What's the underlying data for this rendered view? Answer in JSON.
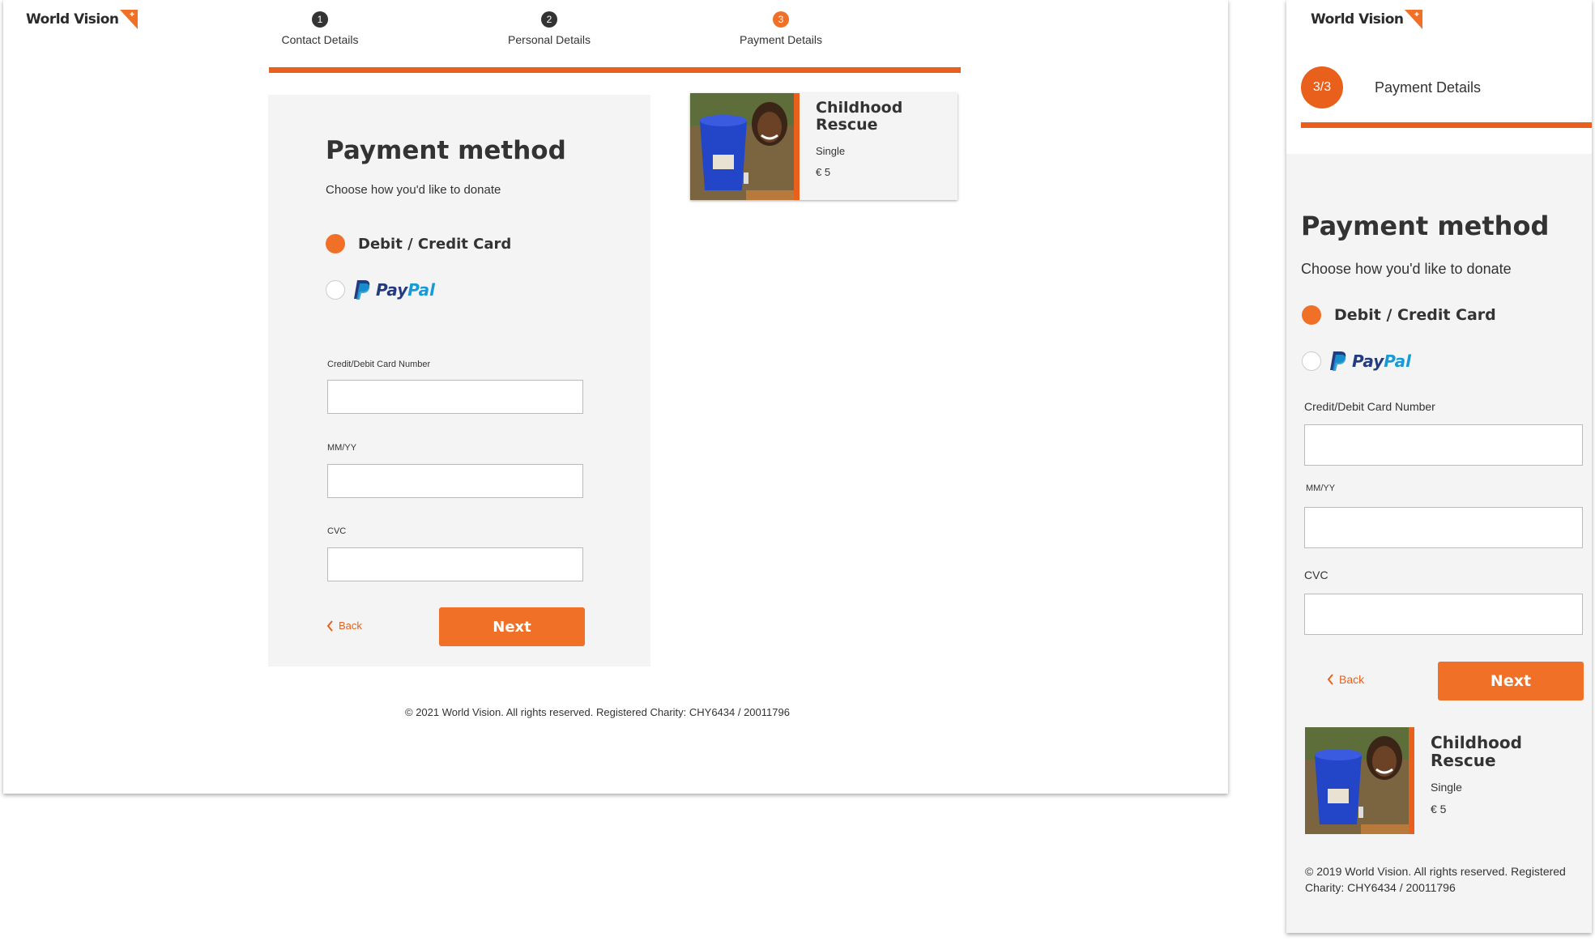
{
  "brand": {
    "name": "World Vision",
    "accent": "#e8601c",
    "accent_light": "#f07028"
  },
  "steps": [
    {
      "num": "1",
      "label": "Contact Details"
    },
    {
      "num": "2",
      "label": "Personal Details"
    },
    {
      "num": "3",
      "label": "Payment Details"
    }
  ],
  "mobile_step": {
    "badge": "3/3",
    "label": "Payment Details"
  },
  "form": {
    "title": "Payment method",
    "subtitle": "Choose how you'd like to donate",
    "options": [
      {
        "label": "Debit / Credit Card",
        "selected": true
      },
      {
        "label_pay": "Pay",
        "label_pal": "Pal",
        "selected": false
      }
    ],
    "fields": [
      {
        "label": "Credit/Debit Card Number",
        "value": ""
      },
      {
        "label": "MM/YY",
        "value": ""
      },
      {
        "label": "CVC",
        "value": ""
      }
    ],
    "back_label": "Back",
    "next_label": "Next"
  },
  "product": {
    "title": "Childhood Rescue",
    "frequency": "Single",
    "amount": "€ 5"
  },
  "footer": {
    "desktop": "© 2021 World Vision. All rights reserved. Registered Charity: CHY6434 /  20011796",
    "mobile": "© 2019 World Vision. All rights reserved. Registered Charity: CHY6434 /  20011796"
  },
  "icons": [
    "world-vision-logo-icon",
    "paypal-logo-icon",
    "chevron-left-icon",
    "child-photo"
  ]
}
